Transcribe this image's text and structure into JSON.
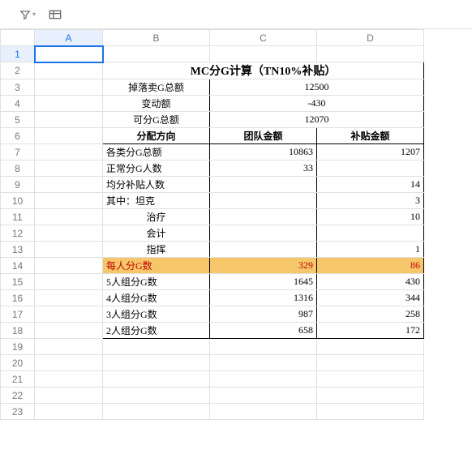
{
  "toolbar": {
    "filter": "filter",
    "pivot": "pivot"
  },
  "columns": [
    "A",
    "B",
    "C",
    "D"
  ],
  "rows": [
    "1",
    "2",
    "3",
    "4",
    "5",
    "6",
    "7",
    "8",
    "9",
    "10",
    "11",
    "12",
    "13",
    "14",
    "15",
    "16",
    "17",
    "18",
    "19",
    "20",
    "21",
    "22",
    "23"
  ],
  "title": "MC分G计算（TN10%补贴）",
  "r3": {
    "label": "掉落卖G总额",
    "value": "12500"
  },
  "r4": {
    "label": "变动额",
    "value": "-430"
  },
  "r5": {
    "label": "可分G总额",
    "value": "12070"
  },
  "r6": {
    "label": "分配方向",
    "c": "团队金额",
    "d": "补贴金额"
  },
  "r7": {
    "label": "各类分G总额",
    "c": "10863",
    "d": "1207"
  },
  "r8": {
    "label": "正常分G人数",
    "c": "33",
    "d": ""
  },
  "r9": {
    "label": "均分补贴人数",
    "c": "",
    "d": "14"
  },
  "r10": {
    "label": "其中：坦克",
    "c": "",
    "d": "3"
  },
  "r11": {
    "label": "治疗",
    "c": "",
    "d": "10"
  },
  "r12": {
    "label": "会计",
    "c": "",
    "d": ""
  },
  "r13": {
    "label": "指挥",
    "c": "",
    "d": "1"
  },
  "r14": {
    "label": "每人分G数",
    "c": "329",
    "d": "86"
  },
  "r15": {
    "label": "5人组分G数",
    "c": "1645",
    "d": "430"
  },
  "r16": {
    "label": "4人组分G数",
    "c": "1316",
    "d": "344"
  },
  "r17": {
    "label": "3人组分G数",
    "c": "987",
    "d": "258"
  },
  "r18": {
    "label": "2人组分G数",
    "c": "658",
    "d": "172"
  }
}
